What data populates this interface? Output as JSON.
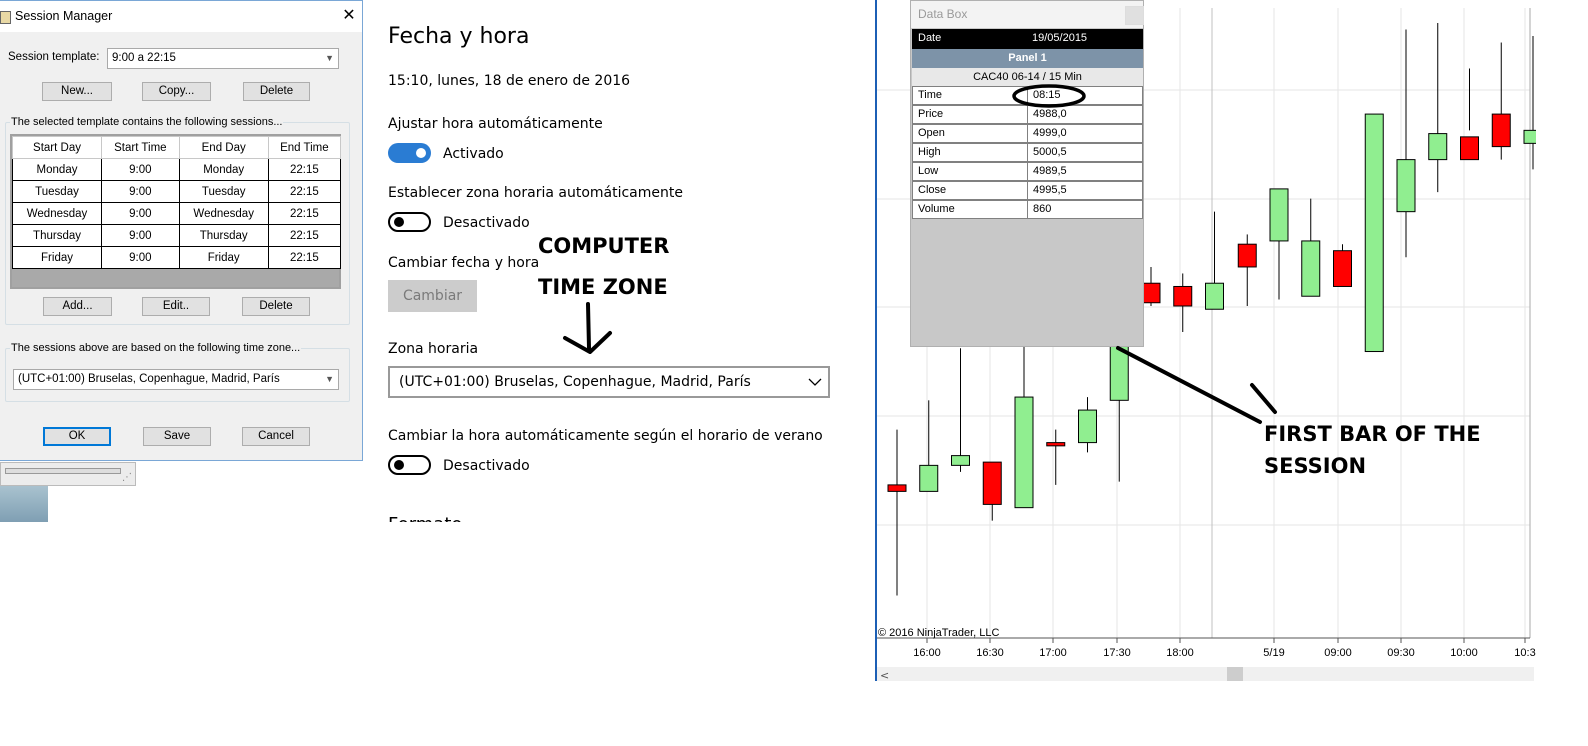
{
  "session_manager": {
    "title": "Session Manager",
    "close_glyph": "✕",
    "template_label": "Session template:",
    "template_value": "9:00 a 22:15",
    "buttons": {
      "new": "New...",
      "copy": "Copy...",
      "delete": "Delete",
      "add": "Add...",
      "edit": "Edit..",
      "delete2": "Delete",
      "ok": "OK",
      "save": "Save",
      "cancel": "Cancel"
    },
    "sessions_caption": "The selected template contains the following sessions...",
    "columns": [
      "Start Day",
      "Start Time",
      "End Day",
      "End Time"
    ],
    "rows": [
      [
        "Monday",
        "9:00",
        "Monday",
        "22:15"
      ],
      [
        "Tuesday",
        "9:00",
        "Tuesday",
        "22:15"
      ],
      [
        "Wednesday",
        "9:00",
        "Wednesday",
        "22:15"
      ],
      [
        "Thursday",
        "9:00",
        "Thursday",
        "22:15"
      ],
      [
        "Friday",
        "9:00",
        "Friday",
        "22:15"
      ]
    ],
    "timezone_caption": "The sessions above are based on the following time zone...",
    "timezone_value": "(UTC+01:00) Bruselas, Copenhague, Madrid, París"
  },
  "settings": {
    "title": "Fecha y hora",
    "datetime": "15:10, lunes, 18 de enero de 2016",
    "auto_time_label": "Ajustar hora automáticamente",
    "auto_time_state": "Activado",
    "auto_tz_label": "Establecer zona horaria automáticamente",
    "auto_tz_state": "Desactivado",
    "change_label": "Cambiar fecha y hora",
    "change_button": "Cambiar",
    "tz_label": "Zona horaria",
    "tz_value": "(UTC+01:00) Bruselas, Copenhague, Madrid, París",
    "dst_label": "Cambiar la hora automáticamente según el horario de verano",
    "dst_state": "Desactivado",
    "cut_text": "Formato"
  },
  "annotations": {
    "computer_tz_line1": "COMPUTER",
    "computer_tz_line2": "TIME ZONE",
    "first_bar_line1": "FIRST BAR OF THE",
    "first_bar_line2": "SESSION"
  },
  "databox": {
    "title": "Data Box",
    "date_label": "Date",
    "date_value": "19/05/2015",
    "panel": "Panel 1",
    "instrument": "CAC40 06-14 / 15 Min",
    "rows": [
      {
        "k": "Time",
        "v": "08:15"
      },
      {
        "k": "Price",
        "v": "4988,0"
      },
      {
        "k": "Open",
        "v": "4999,0"
      },
      {
        "k": "High",
        "v": "5000,5"
      },
      {
        "k": "Low",
        "v": "4989,5"
      },
      {
        "k": "Close",
        "v": "4995,5"
      },
      {
        "k": "Volume",
        "v": "860"
      }
    ]
  },
  "chart": {
    "copyright": "© 2016 NinjaTrader, LLC",
    "x_labels": [
      "16:00",
      "16:30",
      "17:00",
      "17:30",
      "18:00",
      "5/19",
      "09:00",
      "09:30",
      "10:00",
      "10:3"
    ],
    "scroll_left_glyph": "<",
    "up_color": "#90ee90",
    "down_color": "#ff0000"
  },
  "chart_data": {
    "type": "candlestick",
    "title": "",
    "xlabel": "",
    "ylabel": "",
    "x": [
      "15:45",
      "16:00",
      "16:15",
      "16:30",
      "16:45",
      "17:00",
      "17:15",
      "17:30",
      "17:45",
      "18:00",
      "18:15",
      "08:15",
      "08:30",
      "08:45",
      "09:00",
      "09:15",
      "09:30",
      "09:45",
      "10:00",
      "10:15",
      "10:30"
    ],
    "open": [
      4962.0,
      4961.0,
      4965.0,
      4965.5,
      4958.5,
      4968.5,
      4968.5,
      4975.0,
      4993.0,
      4992.5,
      4989.0,
      4999.0,
      4999.5,
      4991.0,
      4998.0,
      4982.5,
      5004.0,
      5012.0,
      5015.5,
      5019.0,
      5014.5
    ],
    "high": [
      4970.5,
      4975.0,
      4983.0,
      4965.5,
      4984.5,
      4970.5,
      4975.5,
      5001.0,
      4995.5,
      4994.5,
      5004.0,
      5000.5,
      5007.5,
      5006.0,
      4999.0,
      5016.5,
      5032.0,
      5033.0,
      5026.0,
      5030.0,
      5031.0
    ],
    "low": [
      4945.0,
      4963.5,
      4964.0,
      4956.5,
      4958.5,
      4962.0,
      4967.0,
      4962.5,
      4989.5,
      4985.5,
      4989.0,
      4989.5,
      4990.5,
      4997.0,
      4992.5,
      4983.0,
      4997.0,
      5007.0,
      5016.5,
      5012.0,
      5010.5
    ],
    "close": [
      4961.0,
      4965.0,
      4966.5,
      4959.0,
      4975.5,
      4968.0,
      4973.5,
      4993.0,
      4990.0,
      4989.5,
      4993.0,
      4995.5,
      5007.5,
      4999.5,
      4992.5,
      5019.0,
      5012.0,
      5016.0,
      5012.0,
      5014.0,
      5016.5
    ],
    "ylim": [
      4940,
      5035
    ],
    "grid": true
  }
}
